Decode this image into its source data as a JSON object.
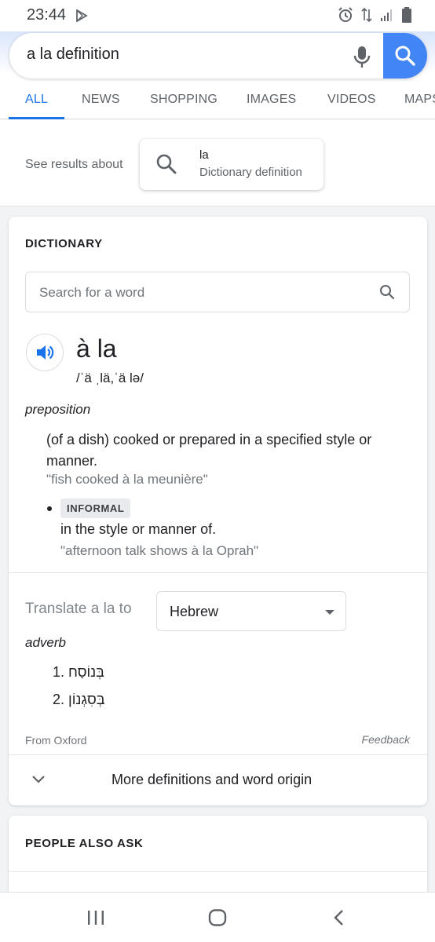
{
  "status_bar": {
    "time": "23:44"
  },
  "search": {
    "query": "a la definition"
  },
  "tabs": [
    {
      "label": "ALL"
    },
    {
      "label": "NEWS"
    },
    {
      "label": "SHOPPING"
    },
    {
      "label": "IMAGES"
    },
    {
      "label": "VIDEOS"
    },
    {
      "label": "MAPS"
    }
  ],
  "see_results": {
    "label": "See results about",
    "chip_title": "la",
    "chip_subtitle": "Dictionary definition"
  },
  "dictionary": {
    "heading": "DICTIONARY",
    "search_placeholder": "Search for a word",
    "headword": "à la",
    "pronunciation": "/ˈä ˌlä,ˈä lə/",
    "part_of_speech": "preposition",
    "definition_1": "(of a dish) cooked or prepared in a specified style or manner.",
    "example_1": "\"fish cooked à la meunière\"",
    "register": "INFORMAL",
    "definition_2": "in the style or manner of.",
    "example_2": "\"afternoon talk shows à la Oprah\"",
    "translate_label": "Translate a la to",
    "translate_language": "Hebrew",
    "translation_pos": "adverb",
    "translations": [
      "1. בְּנוֹסַח",
      "2. בְּסִגְנוֹן"
    ],
    "source": "From Oxford",
    "feedback": "Feedback",
    "more_label": "More definitions and word origin"
  },
  "people_also_ask": {
    "heading": "PEOPLE ALSO ASK"
  },
  "colors": {
    "accent": "#1a73e8",
    "search_button": "#4285f4"
  }
}
